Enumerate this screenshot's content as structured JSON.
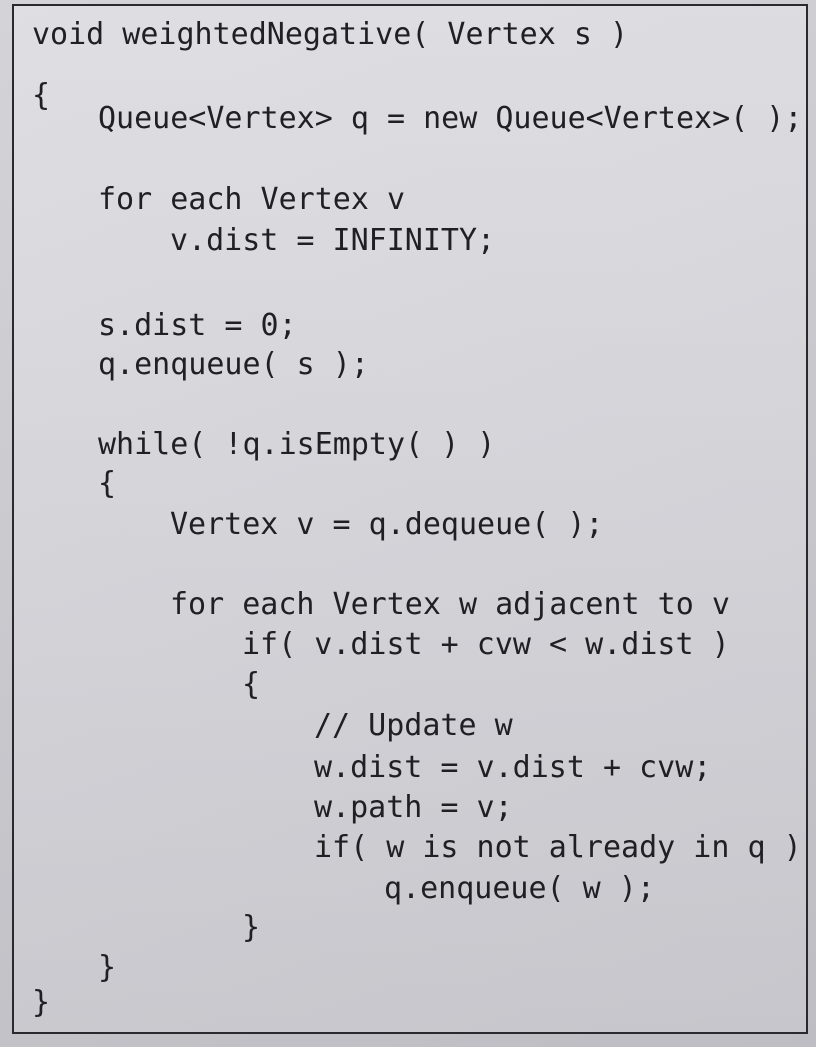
{
  "code": {
    "lines": [
      "void weightedNegative( Vertex s )",
      "{",
      "Queue<Vertex> q = new Queue<Vertex>( );",
      "for each Vertex v",
      "v.dist = INFINITY;",
      "s.dist = 0;",
      "q.enqueue( s );",
      "while( !q.isEmpty( ) )",
      "{",
      "Vertex v = q.dequeue( );",
      "for each Vertex w adjacent to v",
      "if( v.dist + cvw < w.dist )",
      "{",
      "// Update w",
      "w.dist = v.dist + cvw;",
      "w.path = v;",
      "if( w is not already in q )",
      "q.enqueue( w );",
      "}",
      "}",
      "}"
    ]
  }
}
